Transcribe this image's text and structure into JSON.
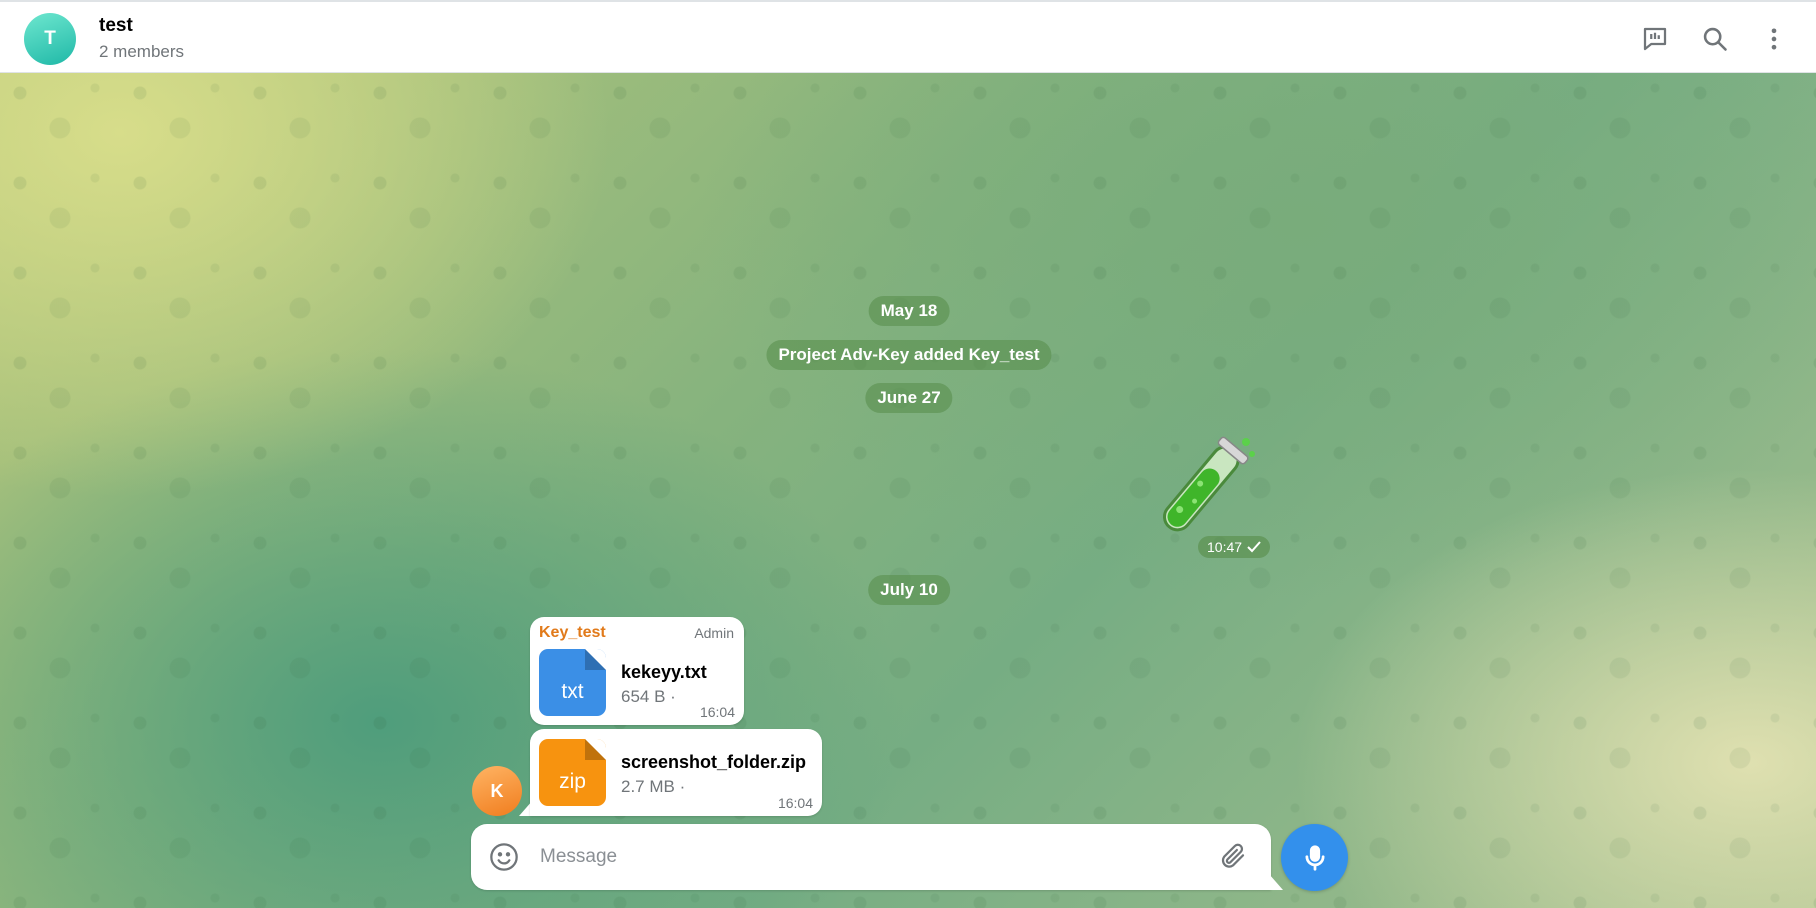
{
  "header": {
    "avatar_letter": "T",
    "title": "test",
    "subtitle": "2 members",
    "accent": "#2cc4b0"
  },
  "timeline": {
    "date1": "May 18",
    "service_message": "Project Adv-Key added Key_test",
    "date2": "June 27",
    "date3": "July 10"
  },
  "sticker": {
    "icon": "test-tube-sticker",
    "time": "10:47",
    "status_icon": "check-icon"
  },
  "messages": [
    {
      "sender": "Key_test",
      "role": "Admin",
      "file_ext": "txt",
      "file_name": "kekeyy.txt",
      "file_size": "654 B ·",
      "time": "16:04"
    },
    {
      "file_ext": "zip",
      "file_name": "screenshot_folder.zip",
      "file_size": "2.7 MB ·",
      "time": "16:04"
    }
  ],
  "sender_avatar_letter": "K",
  "composer": {
    "placeholder": "Message"
  },
  "colors": {
    "primary": "#3390ec",
    "sender_name": "#e17a1a",
    "txt_icon": "#3b8fe6",
    "zip_icon": "#f7930f"
  }
}
